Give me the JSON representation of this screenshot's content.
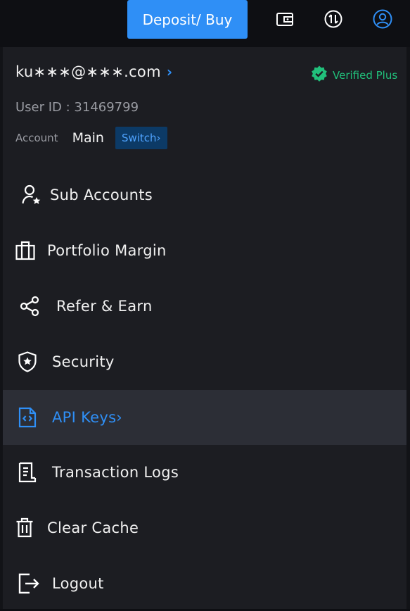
{
  "topbar": {
    "deposit_label": "Deposit/ Buy",
    "icons": [
      "wallet-icon",
      "transfer-icon",
      "user-profile-icon"
    ]
  },
  "account": {
    "email": "ku∗∗∗@∗∗∗.com",
    "email_chevron": "›",
    "verified_label": "Verified Plus",
    "user_id_label": "User ID : 31469799",
    "account_label": "Account",
    "account_value": "Main",
    "switch_label": "Switch›"
  },
  "menu": {
    "items": [
      {
        "label": "Sub Accounts",
        "icon": "sub-accounts-icon"
      },
      {
        "label": "Portfolio Margin",
        "icon": "portfolio-icon"
      },
      {
        "label": "Refer & Earn",
        "icon": "share-icon"
      },
      {
        "label": "Security",
        "icon": "shield-icon"
      },
      {
        "label": "API Keys›",
        "icon": "code-file-icon",
        "active": true
      },
      {
        "label": "Transaction Logs",
        "icon": "document-icon"
      },
      {
        "label": "Clear Cache",
        "icon": "trash-icon"
      },
      {
        "label": "Logout",
        "icon": "logout-icon"
      }
    ]
  },
  "colors": {
    "accent": "#2f8ff6",
    "verified": "#21c07b",
    "panel_bg": "#1c1d22",
    "active_bg": "#2c2e36"
  }
}
